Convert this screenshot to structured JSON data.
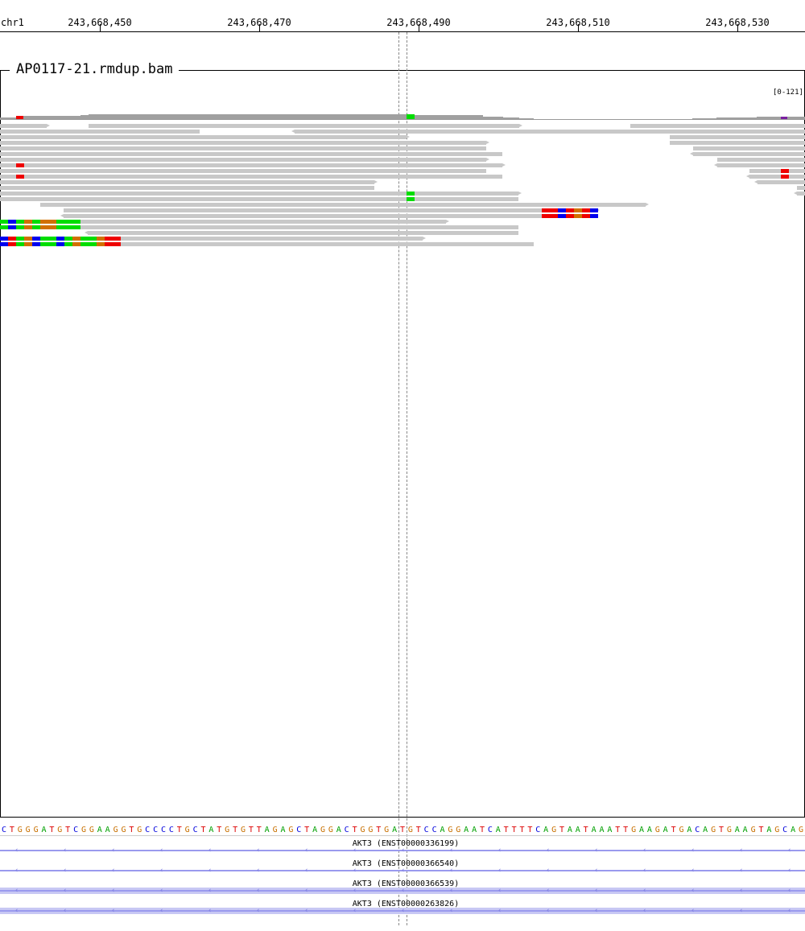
{
  "ruler": {
    "chromosome": "chr1",
    "ticks": [
      "243,668,450",
      "243,668,470",
      "243,668,490",
      "243,668,510",
      "243,668,530"
    ]
  },
  "track": {
    "title": "AP0117-21.rmdup.bam",
    "data_range": "[0-121]"
  },
  "colors": {
    "read": "#c8c8c8",
    "coverage": "#a0a0a0",
    "A": "#00dd00",
    "C": "#0000ee",
    "G": "#d17000",
    "T": "#ee0000",
    "transcript": "#9a9aee"
  },
  "sequence": "CTGGGATGTCGGAAGGTGCCCCTGCTATGTGTTAGAGCTAGGACTGGTGATGTCCAGGAATCATTTTCAGTAATAAATTGAAGATGACAGTGAAGTAGCAG",
  "transcripts": [
    {
      "label": "AKT3 (ENST00000336199)"
    },
    {
      "label": "AKT3 (ENST00000366540)"
    },
    {
      "label": "AKT3 (ENST00000366539)"
    },
    {
      "label": "AKT3 (ENST00000263826)"
    }
  ]
}
